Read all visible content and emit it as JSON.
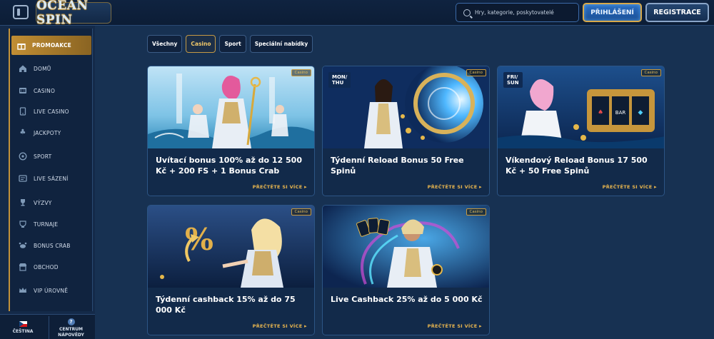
{
  "header": {
    "logo_text": "OCEAN SPIN",
    "search_placeholder": "Hry, kategorie, poskytovatelé",
    "login_label": "PŘIHLÁŠENÍ",
    "register_label": "REGISTRACE"
  },
  "sidebar": {
    "items": [
      {
        "label": "PROMOAKCE",
        "icon": "gift-icon",
        "active": true
      },
      {
        "label": "DOMŮ",
        "icon": "home-icon"
      },
      {
        "label": "CASINO",
        "icon": "casino-icon"
      },
      {
        "label": "LIVE CASINO",
        "icon": "live-casino-icon"
      },
      {
        "label": "JACKPOTY",
        "icon": "jackpot-icon"
      },
      {
        "label": "SPORT",
        "icon": "sport-icon"
      },
      {
        "label": "LIVE SÁZENÍ",
        "icon": "live-betting-icon"
      },
      {
        "label": "VÝZVY",
        "icon": "challenges-icon"
      },
      {
        "label": "TURNAJE",
        "icon": "tournament-icon"
      },
      {
        "label": "BONUS CRAB",
        "icon": "bonus-crab-icon"
      },
      {
        "label": "OBCHOD",
        "icon": "shop-icon"
      },
      {
        "label": "VIP ÚROVNĚ",
        "icon": "vip-icon"
      }
    ],
    "language_label": "ČEŠTINA",
    "help_label_line1": "CENTRUM",
    "help_label_line2": "NÁPOVĚDY"
  },
  "filters": [
    {
      "label": "Všechny",
      "active": false
    },
    {
      "label": "Casino",
      "active": true
    },
    {
      "label": "Sport",
      "active": false
    },
    {
      "label": "Speciální nabídky",
      "active": false
    }
  ],
  "cards": [
    {
      "badge": "Casino",
      "title": "Uvítací bonus 100% až do 12 500 Kč + 200 FS + 1 Bonus Crab",
      "link": "PŘEČTĚTE SI VÍCE",
      "day_badge": ""
    },
    {
      "badge": "Casino",
      "title": "Týdenní Reload Bonus 50 Free Spinů",
      "link": "PŘEČTĚTE SI VÍCE",
      "day_badge": "MON/\nTHU"
    },
    {
      "badge": "Casino",
      "title": "Víkendový Reload Bonus 17 500 Kč + 50 Free Spinů",
      "link": "PŘEČTĚTE SI VÍCE",
      "day_badge": "FRI/\nSUN"
    },
    {
      "badge": "Casino",
      "title": "Týdenní cashback 15% až do 75 000 Kč",
      "link": "PŘEČTĚTE SI VÍCE",
      "day_badge": ""
    },
    {
      "badge": "Casino",
      "title": "Live Cashback 25% až do 5 000 Kč",
      "link": "PŘEČTĚTE SI VÍCE",
      "day_badge": ""
    }
  ],
  "colors": {
    "background": "#173152",
    "accent_gold": "#c18e34",
    "link_gold": "#e9b64f",
    "card_bg": "#122a4a",
    "login_blue": "#2b6fc4"
  }
}
